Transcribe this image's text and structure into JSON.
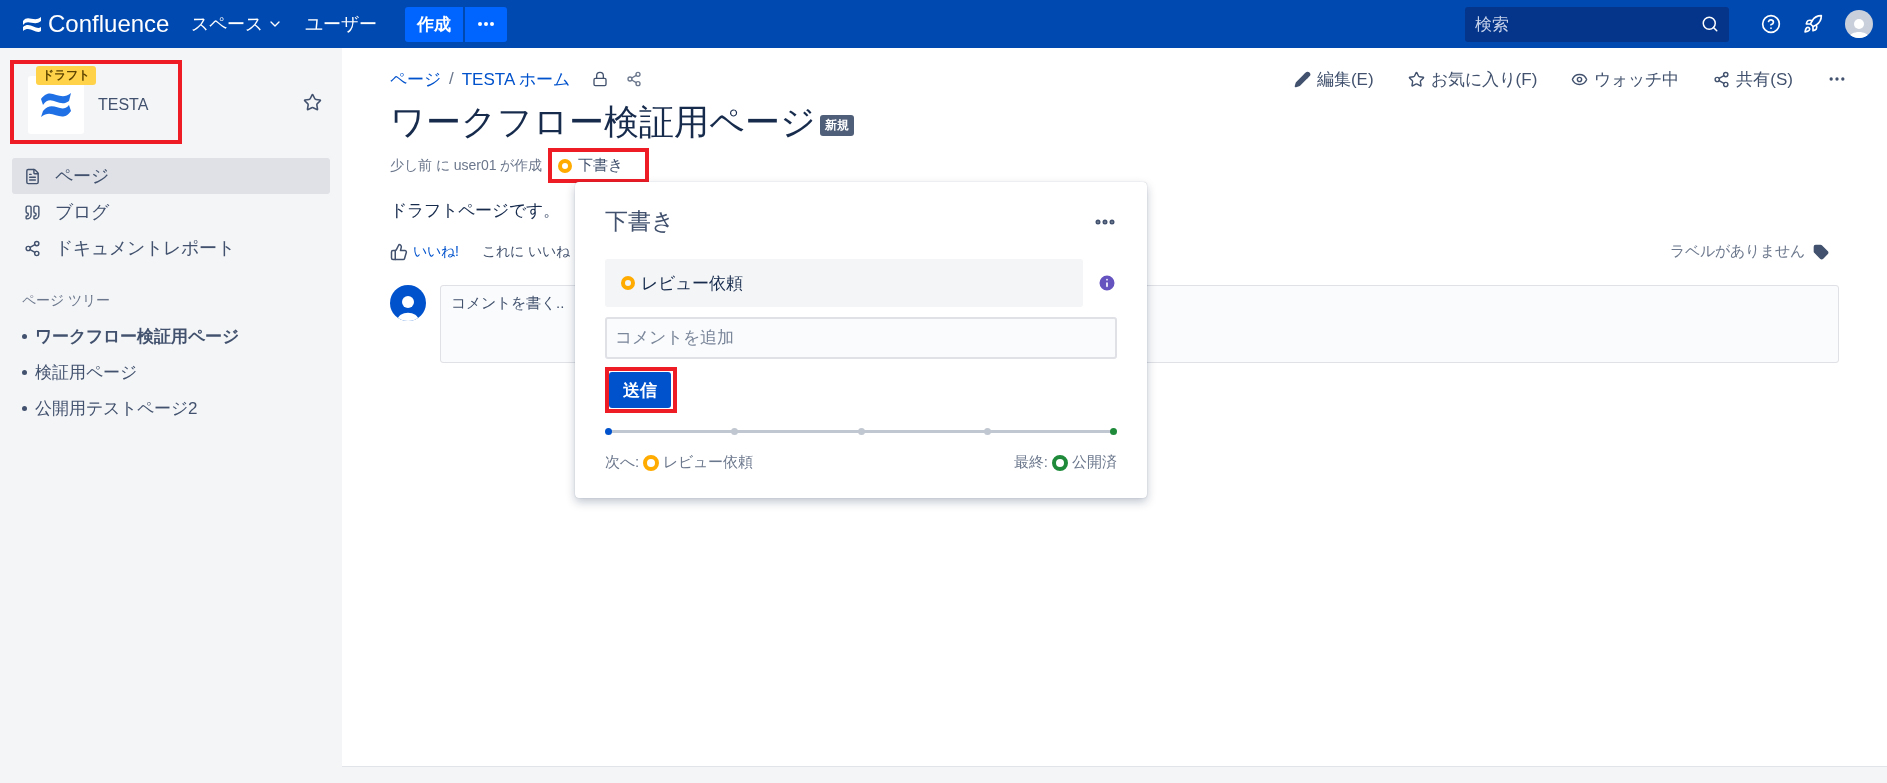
{
  "top_nav": {
    "logo": "Confluence",
    "menus": [
      {
        "label": "スペース",
        "dropdown": true
      },
      {
        "label": "ユーザー",
        "dropdown": false
      }
    ],
    "create_button": "作成",
    "search": {
      "placeholder": "検索"
    }
  },
  "sidebar": {
    "space": {
      "badge": "ドラフト",
      "name": "TESTA",
      "highlighted": true
    },
    "nav": [
      {
        "label": "ページ",
        "kind": "page",
        "selected": true
      },
      {
        "label": "ブログ",
        "kind": "quote",
        "selected": false
      },
      {
        "label": "ドキュメントレポート",
        "kind": "nodes",
        "selected": false
      }
    ],
    "tree_title": "ページ ツリー",
    "tree": [
      {
        "label": "ワークフロー検証用ページ",
        "selected": true
      },
      {
        "label": "検証用ページ",
        "selected": false
      },
      {
        "label": "公開用テストページ2",
        "selected": false
      }
    ]
  },
  "breadcrumbs": [
    "ページ",
    "TESTA ホーム"
  ],
  "breadcrumb_separator": "/",
  "actions": [
    {
      "label": "編集(E)",
      "kind": "edit"
    },
    {
      "label": "お気に入り(F)",
      "kind": "star"
    },
    {
      "label": "ウォッチ中",
      "kind": "watch"
    },
    {
      "label": "共有(S)",
      "kind": "share"
    }
  ],
  "page": {
    "title": "ワークフロー検証用ページ",
    "badge": "新規",
    "byline": "少し前 に user01 が作成",
    "status": {
      "label": "下書き",
      "color": "#ffab00",
      "highlighted": true
    },
    "body": "ドラフトページです。",
    "like": "いいね!",
    "like_note": "これに いいね",
    "labels_empty": "ラベルがありません",
    "comment_placeholder": "コメントを書く.."
  },
  "popup": {
    "title": "下書き",
    "transition": {
      "label": "レビュー依頼",
      "color": "#ffab00"
    },
    "comment": {
      "placeholder": "コメントを追加"
    },
    "submit": {
      "label": "送信",
      "highlighted": true
    },
    "steps": [
      {
        "color": "#0052cc"
      },
      {
        "color": "#c1c7d0"
      },
      {
        "color": "#c1c7d0"
      },
      {
        "color": "#c1c7d0"
      },
      {
        "color": "#1e8a3a"
      }
    ],
    "next": {
      "prefix": "次へ:",
      "label": "レビュー依頼",
      "color": "#ffab00"
    },
    "final": {
      "prefix": "最終:",
      "label": "公開済",
      "color": "#1e8a3a"
    }
  }
}
